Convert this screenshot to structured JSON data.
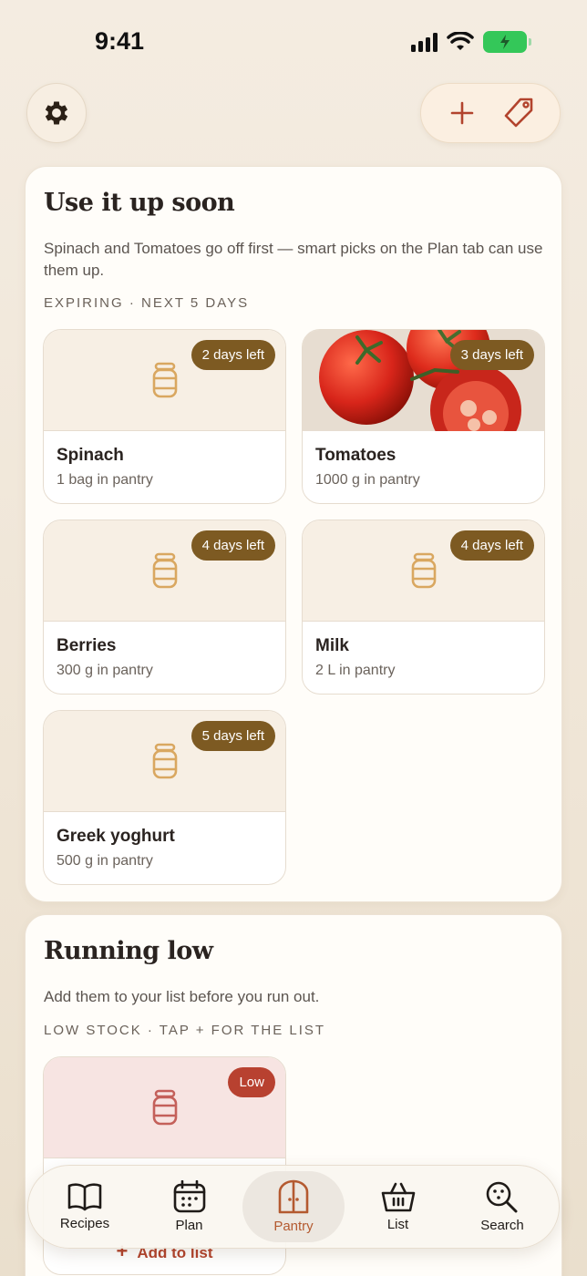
{
  "status_bar": {
    "time": "9:41"
  },
  "expiring": {
    "title": "Use it up soon",
    "description": "Spinach and Tomatoes go off first — smart picks on the Plan tab can use them up.",
    "caption": "EXPIRING · NEXT 5 DAYS",
    "items": [
      {
        "name": "Spinach",
        "quantity": "1 bag in pantry",
        "badge": "2 days left",
        "image": "jar-icon"
      },
      {
        "name": "Tomatoes",
        "quantity": "1000 g in pantry",
        "badge": "3 days left",
        "image": "tomatoes-photo"
      },
      {
        "name": "Berries",
        "quantity": "300 g in pantry",
        "badge": "4 days left",
        "image": "jar-icon"
      },
      {
        "name": "Milk",
        "quantity": "2 L in pantry",
        "badge": "4 days left",
        "image": "jar-icon"
      },
      {
        "name": "Greek yoghurt",
        "quantity": "500 g in pantry",
        "badge": "5 days left",
        "image": "jar-icon"
      }
    ]
  },
  "running_low": {
    "title": "Running low",
    "description": "Add them to your list before you run out.",
    "caption": "LOW STOCK · TAP + FOR THE LIST",
    "items": [
      {
        "badge": "Low",
        "action": "Add to list",
        "image": "jar-icon"
      }
    ]
  },
  "tabs": [
    {
      "label": "Recipes",
      "icon": "book-icon",
      "active": false
    },
    {
      "label": "Plan",
      "icon": "calendar-icon",
      "active": false
    },
    {
      "label": "Pantry",
      "icon": "pantry-icon",
      "active": true
    },
    {
      "label": "List",
      "icon": "basket-icon",
      "active": false
    },
    {
      "label": "Search",
      "icon": "search-icon",
      "active": false
    }
  ],
  "colors": {
    "accent": "#b2432d",
    "badge": "#7d5a22",
    "low_badge": "#b84130",
    "jar": "#d9a760",
    "low_jar": "#c4605a"
  }
}
